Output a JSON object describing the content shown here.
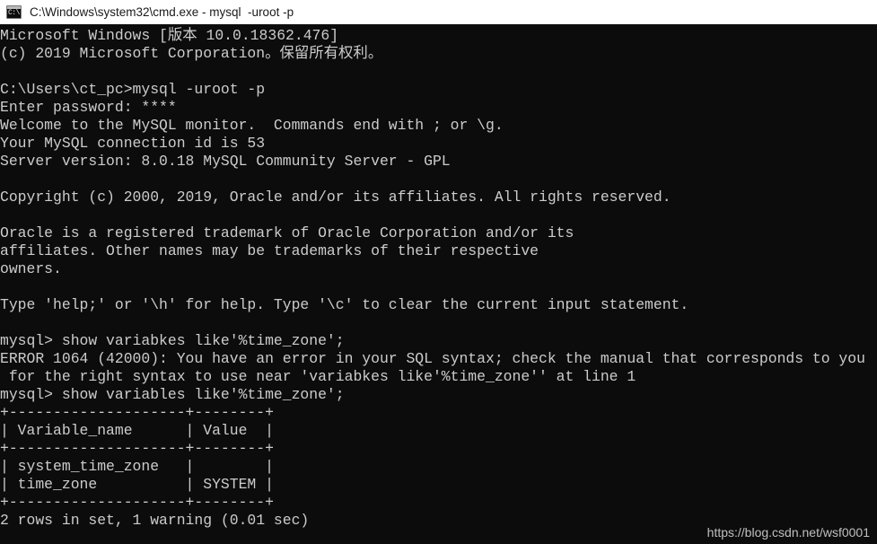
{
  "window": {
    "title": "C:\\Windows\\system32\\cmd.exe - mysql  -uroot -p",
    "icon": "cmd-console-icon",
    "icon_prompt": "C:\\",
    "background_color": "#0c0c0c",
    "text_color": "#cccccc",
    "titlebar_color": "#ffffff"
  },
  "terminal": {
    "lines": [
      "Microsoft Windows [版本 10.0.18362.476]",
      "(c) 2019 Microsoft Corporation。保留所有权利。",
      "",
      "C:\\Users\\ct_pc>mysql -uroot -p",
      "Enter password: ****",
      "Welcome to the MySQL monitor.  Commands end with ; or \\g.",
      "Your MySQL connection id is 53",
      "Server version: 8.0.18 MySQL Community Server - GPL",
      "",
      "Copyright (c) 2000, 2019, Oracle and/or its affiliates. All rights reserved.",
      "",
      "Oracle is a registered trademark of Oracle Corporation and/or its",
      "affiliates. Other names may be trademarks of their respective",
      "owners.",
      "",
      "Type 'help;' or '\\h' for help. Type '\\c' to clear the current input statement.",
      "",
      "mysql> show variabkes like'%time_zone';",
      "ERROR 1064 (42000): You have an error in your SQL syntax; check the manual that corresponds to you",
      " for the right syntax to use near 'variabkes like'%time_zone'' at line 1",
      "mysql> show variables like'%time_zone';",
      "+--------------------+--------+",
      "| Variable_name      | Value  |",
      "+--------------------+--------+",
      "| system_time_zone   |        |",
      "| time_zone          | SYSTEM |",
      "+--------------------+--------+",
      "2 rows in set, 1 warning (0.01 sec)"
    ],
    "command_1": "show variabkes like'%time_zone';",
    "command_2": "show variables like'%time_zone';",
    "prompt": "mysql>",
    "error_code": "ERROR 1064 (42000)",
    "sqlstate": "42000",
    "mysql_version": "8.0.18",
    "connection_id": "53",
    "server_edition": "MySQL Community Server - GPL",
    "windows_version": "10.0.18362.476",
    "result_summary": "2 rows in set, 1 warning (0.01 sec)",
    "rows_count": "2",
    "warnings_count": "1",
    "elapsed": "0.01 sec"
  },
  "result_table": {
    "headers": [
      "Variable_name",
      "Value"
    ],
    "rows": [
      [
        "system_time_zone",
        ""
      ],
      [
        "time_zone",
        "SYSTEM"
      ]
    ]
  },
  "watermark": {
    "text": "https://blog.csdn.net/wsf0001"
  }
}
